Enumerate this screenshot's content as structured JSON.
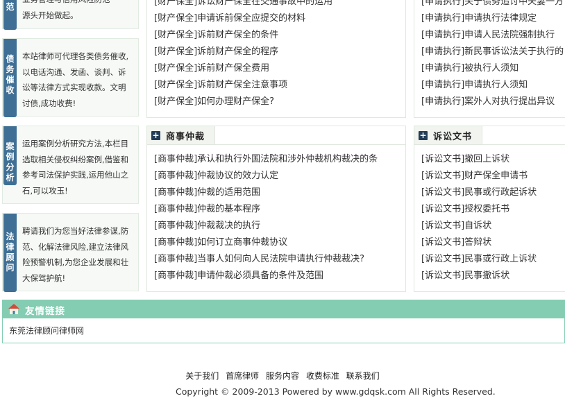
{
  "services": [
    {
      "tag": "范",
      "lines": [
        "业务管理与信用风险防范",
        "源头开始做起。"
      ]
    },
    {
      "tag": "债务催收",
      "lines": [
        "本站律师可代理各类债务催收,",
        "以电话沟通、发函、谈判、诉",
        "讼等法律方式实现收款。文明",
        "讨债,成功收费!"
      ]
    },
    {
      "tag": "案例分析",
      "lines": [
        "运用案例分析研究方法,本栏目",
        "选取相关侵权纠纷案例,借鉴和",
        "参考司法保护实践,运用他山之",
        "石,可以攻玉!"
      ]
    },
    {
      "tag": "法律顾问",
      "lines": [
        "聘请我们为您当好法律参谋,防",
        "范、化解法律风险,建立法律风",
        "险预警机制,为您企业发展和壮",
        "大保驾护航!"
      ]
    }
  ],
  "property_list": [
    "[财产保全]诉讼财产保全在交通事故中的运用",
    "[财产保全]申请诉前保全应提交的材料",
    "[财产保全]诉前财产保全的条件",
    "[财产保全]诉前财产保全的程序",
    "[财产保全]诉前财产保全费用",
    "[财产保全]诉前财产保全注意事项",
    "[财产保全]如何办理财产保全?"
  ],
  "execution_list": [
    "[申请执行]关于债务追讨中夫妻一方",
    "[申请执行]申请执行法律规定",
    "[申请执行]申请人民法院强制执行",
    "[申请执行]新民事诉讼法关于执行的",
    "[申请执行]被执行人须知",
    "[申请执行]申请执行人须知",
    "[申请执行]案外人对执行提出异议"
  ],
  "arbitration": {
    "title": "商事仲裁",
    "items": [
      "[商事仲裁]承认和执行外国法院和涉外仲裁机构裁决的条",
      "[商事仲裁]仲裁协议的效力认定",
      "[商事仲裁]仲裁的适用范围",
      "[商事仲裁]仲裁的基本程序",
      "[商事仲裁]仲裁裁决的执行",
      "[商事仲裁]如何订立商事仲裁协议",
      "[商事仲裁]当事人如何向人民法院申请执行仲裁裁决?",
      "[商事仲裁]申请仲裁必须具备的条件及范围"
    ]
  },
  "documents": {
    "title": "诉讼文书",
    "items": [
      "[诉讼文书]撤回上诉状",
      "[诉讼文书]财产保全申请书",
      "[诉讼文书]民事或行政起诉状",
      "[诉讼文书]授权委托书",
      "[诉讼文书]自诉状",
      "[诉讼文书]答辩状",
      "[诉讼文书]民事或行政上诉状",
      "[诉讼文书]民事撤诉状"
    ]
  },
  "friend_links": {
    "title": "友情链接",
    "items": [
      "东莞法律顾问律师网"
    ]
  },
  "footer": {
    "links": [
      "关于我们",
      "首席律师",
      "服务内容",
      "收费标准",
      "联系我们"
    ],
    "copyright": "Copyright © 2009-2013 Powered by www.gdqsk.com All Rights Reserved."
  },
  "colors": {
    "tag_blue": "#3f6f95",
    "friend_bar": "#84cdb3",
    "panel_icon": "#233d58"
  }
}
